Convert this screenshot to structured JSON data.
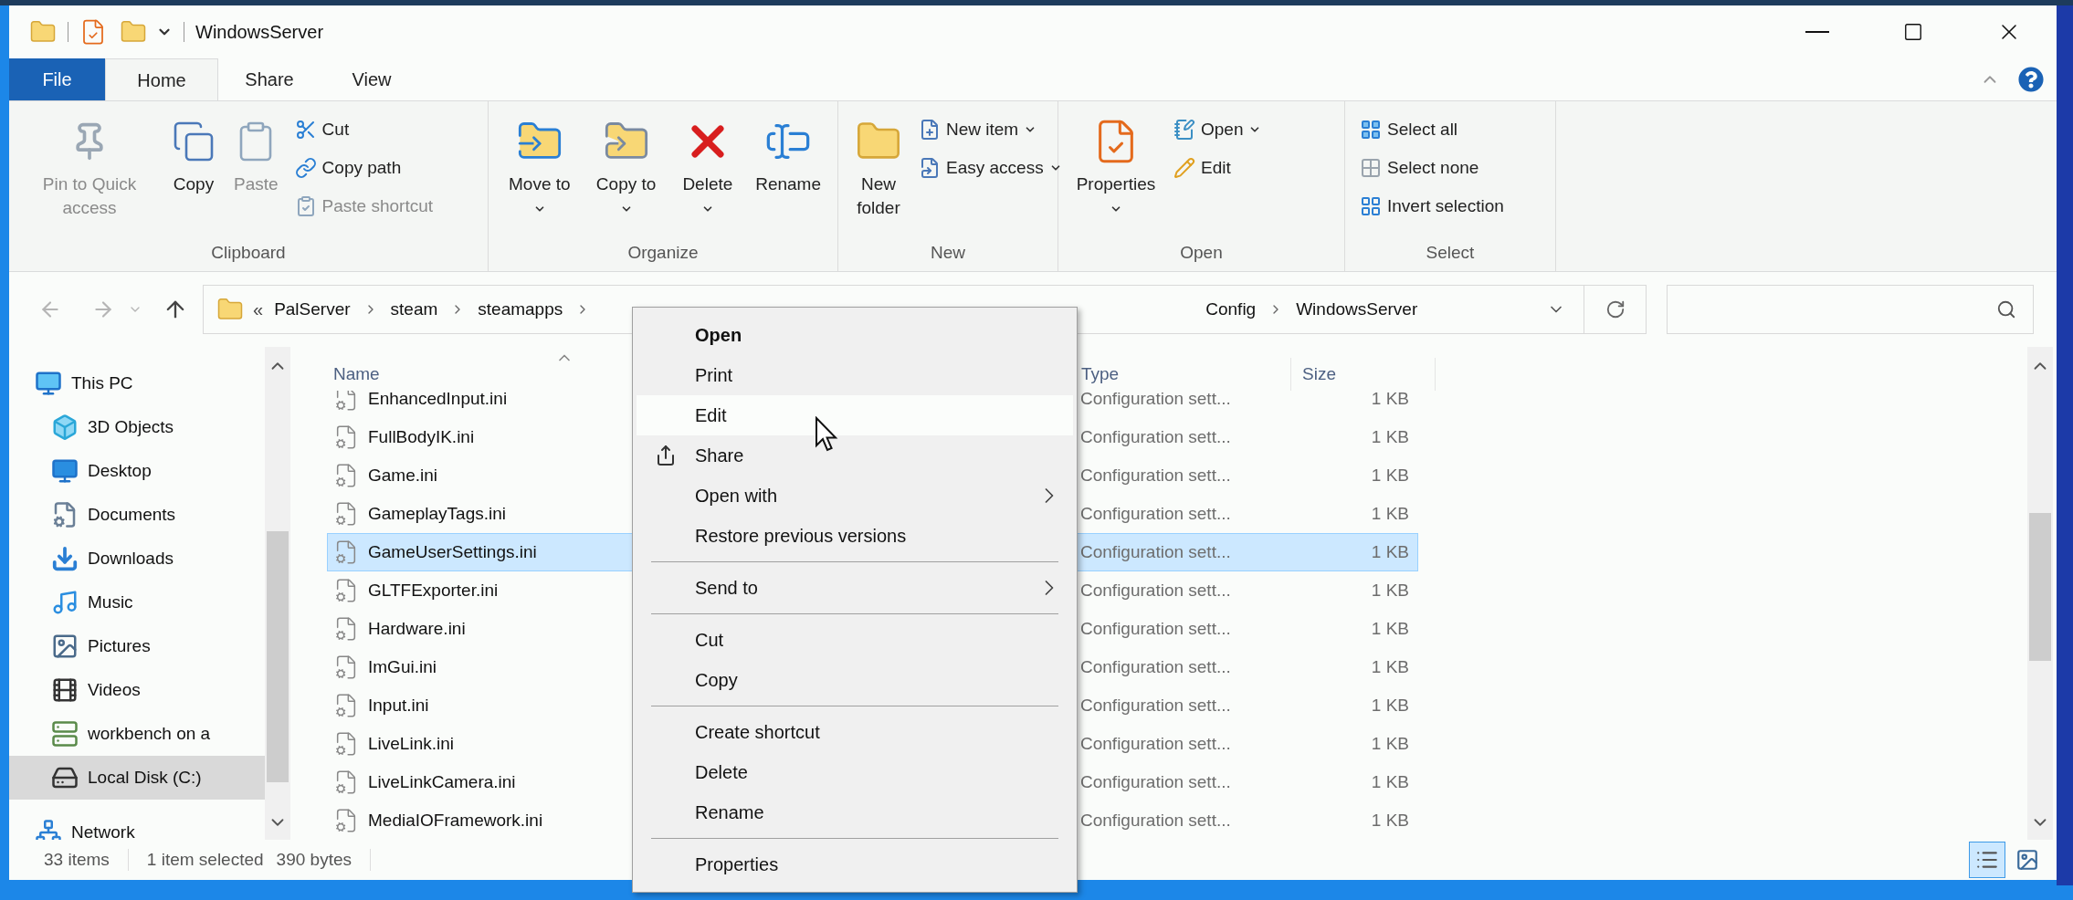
{
  "window": {
    "title": "WindowsServer"
  },
  "ribbon_tabs": [
    {
      "label": "File",
      "kind": "file",
      "selected": false
    },
    {
      "label": "Home",
      "kind": "tab",
      "selected": true
    },
    {
      "label": "Share",
      "kind": "tab",
      "selected": false
    },
    {
      "label": "View",
      "kind": "tab",
      "selected": false
    }
  ],
  "ribbon_groups": [
    {
      "label": "Clipboard",
      "large": [
        {
          "label": "Pin to Quick access",
          "disabled": true,
          "dropdown": false
        },
        {
          "label": "Copy",
          "disabled": false,
          "dropdown": false
        },
        {
          "label": "Paste",
          "disabled": true,
          "dropdown": false
        }
      ],
      "small": [
        {
          "label": "Cut",
          "disabled": false,
          "dropdown": false
        },
        {
          "label": "Copy path",
          "disabled": false,
          "dropdown": false
        },
        {
          "label": "Paste shortcut",
          "disabled": true,
          "dropdown": false
        }
      ]
    },
    {
      "label": "Organize",
      "large": [
        {
          "label": "Move to",
          "disabled": false,
          "dropdown": true
        },
        {
          "label": "Copy to",
          "disabled": false,
          "dropdown": true
        },
        {
          "label": "Delete",
          "disabled": false,
          "dropdown": true
        },
        {
          "label": "Rename",
          "disabled": false,
          "dropdown": false
        }
      ]
    },
    {
      "label": "New",
      "large": [
        {
          "label": "New folder",
          "disabled": false,
          "dropdown": false
        }
      ],
      "small": [
        {
          "label": "New item",
          "disabled": false,
          "dropdown": true
        },
        {
          "label": "Easy access",
          "disabled": false,
          "dropdown": true
        }
      ]
    },
    {
      "label": "Open",
      "large": [
        {
          "label": "Properties",
          "disabled": false,
          "dropdown": true
        }
      ],
      "small": [
        {
          "label": "Open",
          "disabled": false,
          "dropdown": true
        },
        {
          "label": "Edit",
          "disabled": false,
          "dropdown": false
        }
      ]
    },
    {
      "label": "Select",
      "small": [
        {
          "label": "Select all",
          "disabled": false,
          "dropdown": false
        },
        {
          "label": "Select none",
          "disabled": false,
          "dropdown": false
        },
        {
          "label": "Invert selection",
          "disabled": false,
          "dropdown": false
        }
      ]
    }
  ],
  "address": {
    "overflow": "«",
    "visible_start": [
      "PalServer",
      "steam",
      "steamapps"
    ],
    "visible_end": [
      "Config",
      "WindowsServer"
    ]
  },
  "nav": [
    {
      "label": "This PC",
      "selected": false,
      "children": [
        {
          "label": "3D Objects",
          "selected": false
        },
        {
          "label": "Desktop",
          "selected": false
        },
        {
          "label": "Documents",
          "selected": false
        },
        {
          "label": "Downloads",
          "selected": false
        },
        {
          "label": "Music",
          "selected": false
        },
        {
          "label": "Pictures",
          "selected": false
        },
        {
          "label": "Videos",
          "selected": false
        },
        {
          "label": "workbench on a",
          "selected": false
        },
        {
          "label": "Local Disk (C:)",
          "selected": true
        }
      ]
    },
    {
      "label": "Network",
      "selected": false
    }
  ],
  "columns": {
    "name": "Name",
    "type": "Type",
    "size": "Size"
  },
  "files": [
    {
      "name": "EnhancedInput.ini",
      "type": "Configuration sett...",
      "size": "1 KB",
      "selected": false
    },
    {
      "name": "FullBodyIK.ini",
      "type": "Configuration sett...",
      "size": "1 KB",
      "selected": false
    },
    {
      "name": "Game.ini",
      "type": "Configuration sett...",
      "size": "1 KB",
      "selected": false
    },
    {
      "name": "GameplayTags.ini",
      "type": "Configuration sett...",
      "size": "1 KB",
      "selected": false
    },
    {
      "name": "GameUserSettings.ini",
      "type": "Configuration sett...",
      "size": "1 KB",
      "selected": true
    },
    {
      "name": "GLTFExporter.ini",
      "type": "Configuration sett...",
      "size": "1 KB",
      "selected": false
    },
    {
      "name": "Hardware.ini",
      "type": "Configuration sett...",
      "size": "1 KB",
      "selected": false
    },
    {
      "name": "ImGui.ini",
      "type": "Configuration sett...",
      "size": "1 KB",
      "selected": false
    },
    {
      "name": "Input.ini",
      "type": "Configuration sett...",
      "size": "1 KB",
      "selected": false
    },
    {
      "name": "LiveLink.ini",
      "type": "Configuration sett...",
      "size": "1 KB",
      "selected": false
    },
    {
      "name": "LiveLinkCamera.ini",
      "type": "Configuration sett...",
      "size": "1 KB",
      "selected": false
    },
    {
      "name": "MediaIOFramework.ini",
      "type": "Configuration sett...",
      "size": "1 KB",
      "selected": false
    }
  ],
  "context_menu": [
    {
      "kind": "item",
      "label": "Open",
      "bold": true,
      "highlighted": false,
      "submenu": false,
      "icon": false
    },
    {
      "kind": "item",
      "label": "Print",
      "bold": false,
      "highlighted": false,
      "submenu": false,
      "icon": false
    },
    {
      "kind": "item",
      "label": "Edit",
      "bold": false,
      "highlighted": true,
      "submenu": false,
      "icon": false
    },
    {
      "kind": "item",
      "label": "Share",
      "bold": false,
      "highlighted": false,
      "submenu": false,
      "icon": true
    },
    {
      "kind": "item",
      "label": "Open with",
      "bold": false,
      "highlighted": false,
      "submenu": true,
      "icon": false
    },
    {
      "kind": "item",
      "label": "Restore previous versions",
      "bold": false,
      "highlighted": false,
      "submenu": false,
      "icon": false
    },
    {
      "kind": "separator"
    },
    {
      "kind": "item",
      "label": "Send to",
      "bold": false,
      "highlighted": false,
      "submenu": true,
      "icon": false
    },
    {
      "kind": "separator"
    },
    {
      "kind": "item",
      "label": "Cut",
      "bold": false,
      "highlighted": false,
      "submenu": false,
      "icon": false
    },
    {
      "kind": "item",
      "label": "Copy",
      "bold": false,
      "highlighted": false,
      "submenu": false,
      "icon": false
    },
    {
      "kind": "separator"
    },
    {
      "kind": "item",
      "label": "Create shortcut",
      "bold": false,
      "highlighted": false,
      "submenu": false,
      "icon": false
    },
    {
      "kind": "item",
      "label": "Delete",
      "bold": false,
      "highlighted": false,
      "submenu": false,
      "icon": false
    },
    {
      "kind": "item",
      "label": "Rename",
      "bold": false,
      "highlighted": false,
      "submenu": false,
      "icon": false
    },
    {
      "kind": "separator"
    },
    {
      "kind": "item",
      "label": "Properties",
      "bold": false,
      "highlighted": false,
      "submenu": false,
      "icon": false
    }
  ],
  "status_bar": {
    "item_count": "33 items",
    "selection": "1 item selected",
    "selection_size": "390 bytes"
  },
  "view_modes": [
    {
      "kind": "details",
      "selected": true
    },
    {
      "kind": "large_icons",
      "selected": false
    }
  ]
}
